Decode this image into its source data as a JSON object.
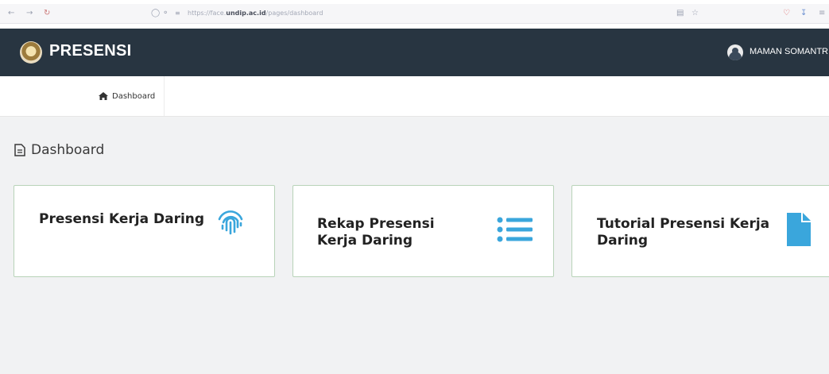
{
  "browser": {
    "url_prefix": "https://face.",
    "url_domain": "undip.ac.id",
    "url_path": "/pages/dashboard"
  },
  "header": {
    "app_title": "PRESENSI",
    "user_name": "MAMAN SOMANTRI"
  },
  "nav": {
    "items": [
      {
        "label": "Dashboard",
        "icon": "home-icon"
      }
    ]
  },
  "main": {
    "page_title": "Dashboard",
    "cards": [
      {
        "title": "Presensi Kerja Daring",
        "icon": "fingerprint-icon"
      },
      {
        "title": "Rekap Presensi Kerja Daring",
        "icon": "list-icon"
      },
      {
        "title": "Tutorial Presensi Kerja Daring",
        "icon": "file-icon"
      }
    ]
  },
  "colors": {
    "header_bg": "#283541",
    "accent_icon": "#3aa6dc",
    "card_border": "#b8d3b8",
    "content_bg": "#f1f2f3"
  }
}
